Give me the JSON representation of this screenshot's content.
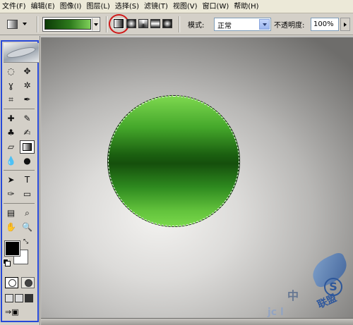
{
  "menu": [
    "文件(F)",
    "编辑(E)",
    "图像(I)",
    "图层(L)",
    "选择(S)",
    "滤镜(T)",
    "视图(V)",
    "窗口(W)",
    "帮助(H)"
  ],
  "options": {
    "mode_label": "模式:",
    "mode_value": "正常",
    "opacity_label": "不透明度:",
    "opacity_value": "100%",
    "gradient_colors": [
      "#0c3a06",
      "#2d7a1c",
      "#7fd05a"
    ],
    "selected_gradient_type": "linear"
  },
  "toolbox": {
    "foreground_color": "#000000",
    "background_color": "#ffffff",
    "active_tool": "gradient-tool"
  },
  "canvas": {
    "circle_gradient": [
      "#7ed84f",
      "#1b6010",
      "#7ad84b"
    ]
  },
  "watermark": {
    "cn_text": "中",
    "brand_text": "联盟",
    "url_text": "jc  l"
  }
}
